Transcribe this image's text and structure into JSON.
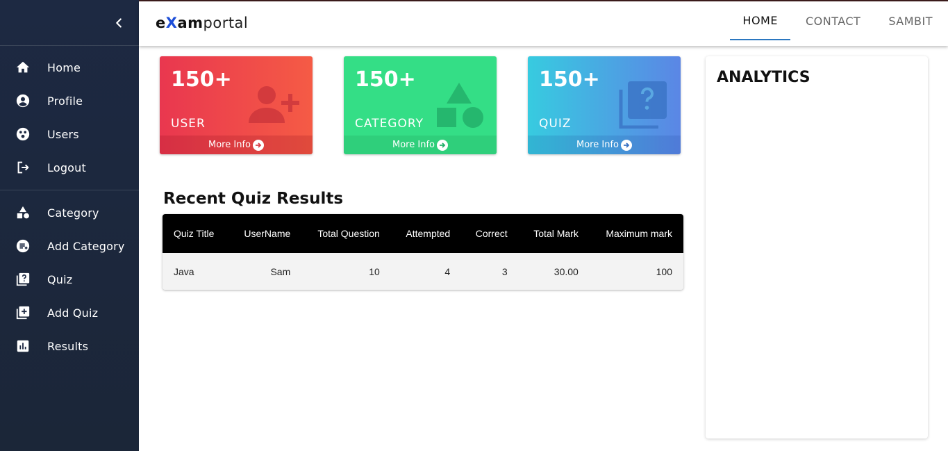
{
  "brand": {
    "e": "e",
    "x": "X",
    "am": "am",
    "rest": "portal"
  },
  "nav": [
    {
      "label": "HOME",
      "active": true
    },
    {
      "label": "CONTACT",
      "active": false
    },
    {
      "label": "SAMBIT",
      "active": false
    }
  ],
  "sidebar": {
    "group1": [
      {
        "label": "Home",
        "icon": "home-icon"
      },
      {
        "label": "Profile",
        "icon": "account-circle-icon"
      },
      {
        "label": "Users",
        "icon": "users-icon"
      },
      {
        "label": "Logout",
        "icon": "logout-icon"
      }
    ],
    "group2": [
      {
        "label": "Category",
        "icon": "category-icon"
      },
      {
        "label": "Add Category",
        "icon": "playlist-add-icon"
      },
      {
        "label": "Quiz",
        "icon": "quiz-icon"
      },
      {
        "label": "Add Quiz",
        "icon": "library-add-icon"
      },
      {
        "label": "Results",
        "icon": "chart-icon"
      }
    ]
  },
  "cards": [
    {
      "value": "150+",
      "caption": "USER",
      "more": "More Info",
      "icon": "person-add-icon"
    },
    {
      "value": "150+",
      "caption": "CATEGORY",
      "more": "More Info",
      "icon": "category-icon"
    },
    {
      "value": "150+",
      "caption": "QUIZ",
      "more": "More Info",
      "icon": "quiz-icon"
    }
  ],
  "recent": {
    "title": "Recent Quiz Results",
    "columns": [
      "Quiz Title",
      "UserName",
      "Total Question",
      "Attempted",
      "Correct",
      "Total Mark",
      "Maximum mark"
    ],
    "rows": [
      [
        "Java",
        "Sam",
        "10",
        "4",
        "3",
        "30.00",
        "100"
      ]
    ]
  },
  "analytics": {
    "title": "ANALYTICS"
  },
  "colors": {
    "sidebar": "#1d2942",
    "user_card": "#ee4a4a",
    "category_card": "#34de86",
    "quiz_card": "#4aa8e2",
    "nav_underline": "#2b77c0"
  }
}
